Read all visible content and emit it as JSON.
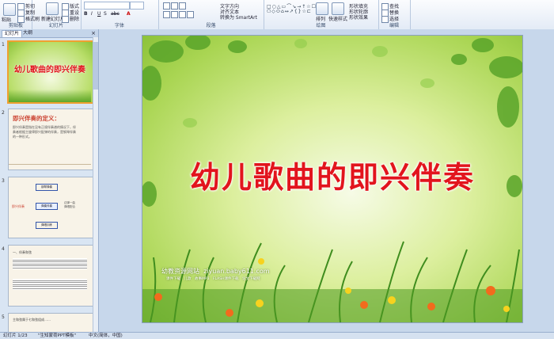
{
  "ribbon": {
    "groups": [
      {
        "label": "剪贴板",
        "items": [
          "粘贴",
          "剪切",
          "复制",
          "格式刷"
        ]
      },
      {
        "label": "幻灯片",
        "items": [
          "新建幻灯片",
          "版式",
          "重设",
          "删除"
        ]
      },
      {
        "label": "字体",
        "items": [
          "B",
          "I",
          "U",
          "S",
          "abc",
          "A"
        ]
      },
      {
        "label": "段落",
        "items": [
          "文字方向",
          "对齐文本",
          "转换为 SmartArt"
        ]
      },
      {
        "label": "绘图",
        "items": [
          "排列",
          "快速样式",
          "形状填充",
          "形状轮廓",
          "形状效果"
        ]
      },
      {
        "label": "编辑",
        "items": [
          "查找",
          "替换",
          "选择"
        ]
      }
    ]
  },
  "pane": {
    "tab_slides": "幻灯片",
    "tab_outline": "大纲",
    "close": "×",
    "slides": [
      {
        "num": "1",
        "title": "幼儿歌曲的即兴伴奏"
      },
      {
        "num": "2",
        "title": "即兴伴奏的定义：",
        "text": "即兴伴奏是指在没有正规伴奏谱的情况下，伴奏者根据主旋律即兴配弹的伴奏，是钢琴伴奏的一种形式。"
      },
      {
        "num": "3",
        "left": "即兴伴奏",
        "boxes": [
          "钢琴弹奏",
          "弹奏伴奏",
          "弹唱训练"
        ],
        "right": "边弹一曲\n弹唱配合"
      },
      {
        "num": "4",
        "heading": "一、伴奏和弦"
      },
      {
        "num": "5",
        "text": "主和弦属于七和弦组成……"
      }
    ]
  },
  "slide": {
    "title": "幼儿歌曲的即兴伴奏",
    "site_name": "幼教资源网站",
    "site_url": "ziyuan.baby611.com",
    "site_tags": "课件下载　儿歌　故事MP3　FLASH课件下载　论文下载网"
  },
  "status": {
    "slide_counter": "幻灯片 1/23",
    "theme": "\"生知蒙荷PPT模板\"",
    "language": "中文(简体，中国)"
  },
  "colors": {
    "title_red": "#e2141d",
    "accent_orange": "#f0a030"
  }
}
